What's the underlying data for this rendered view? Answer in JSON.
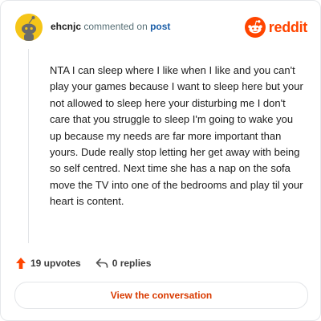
{
  "header": {
    "username": "ehcnjc",
    "action_text": "commented on",
    "post_link": "post",
    "brand": "reddit"
  },
  "comment": {
    "text": "NTA I can sleep where I like when I like and you can't play your games because I want to sleep here but your not allowed to sleep here your disturbing me I don't care that you struggle to sleep I'm going to wake you up because my needs are far more important than yours. Dude really stop letting her get away with being so self centred. Next time she has a nap on the sofa move the TV into one of the bedrooms and play til your heart is content."
  },
  "actions": {
    "upvotes_label": "19 upvotes",
    "replies_label": "0 replies"
  },
  "cta": {
    "label": "View the conversation"
  },
  "colors": {
    "brand": "#ff4500",
    "avatar_bg": "#f5c518",
    "link": "#1c5fa8",
    "cta_text": "#d93a00"
  },
  "icons": {
    "avatar": "snoo-avatar-icon",
    "brand": "reddit-logo-icon",
    "upvote": "upvote-arrow-icon",
    "reply": "reply-arrow-icon"
  }
}
